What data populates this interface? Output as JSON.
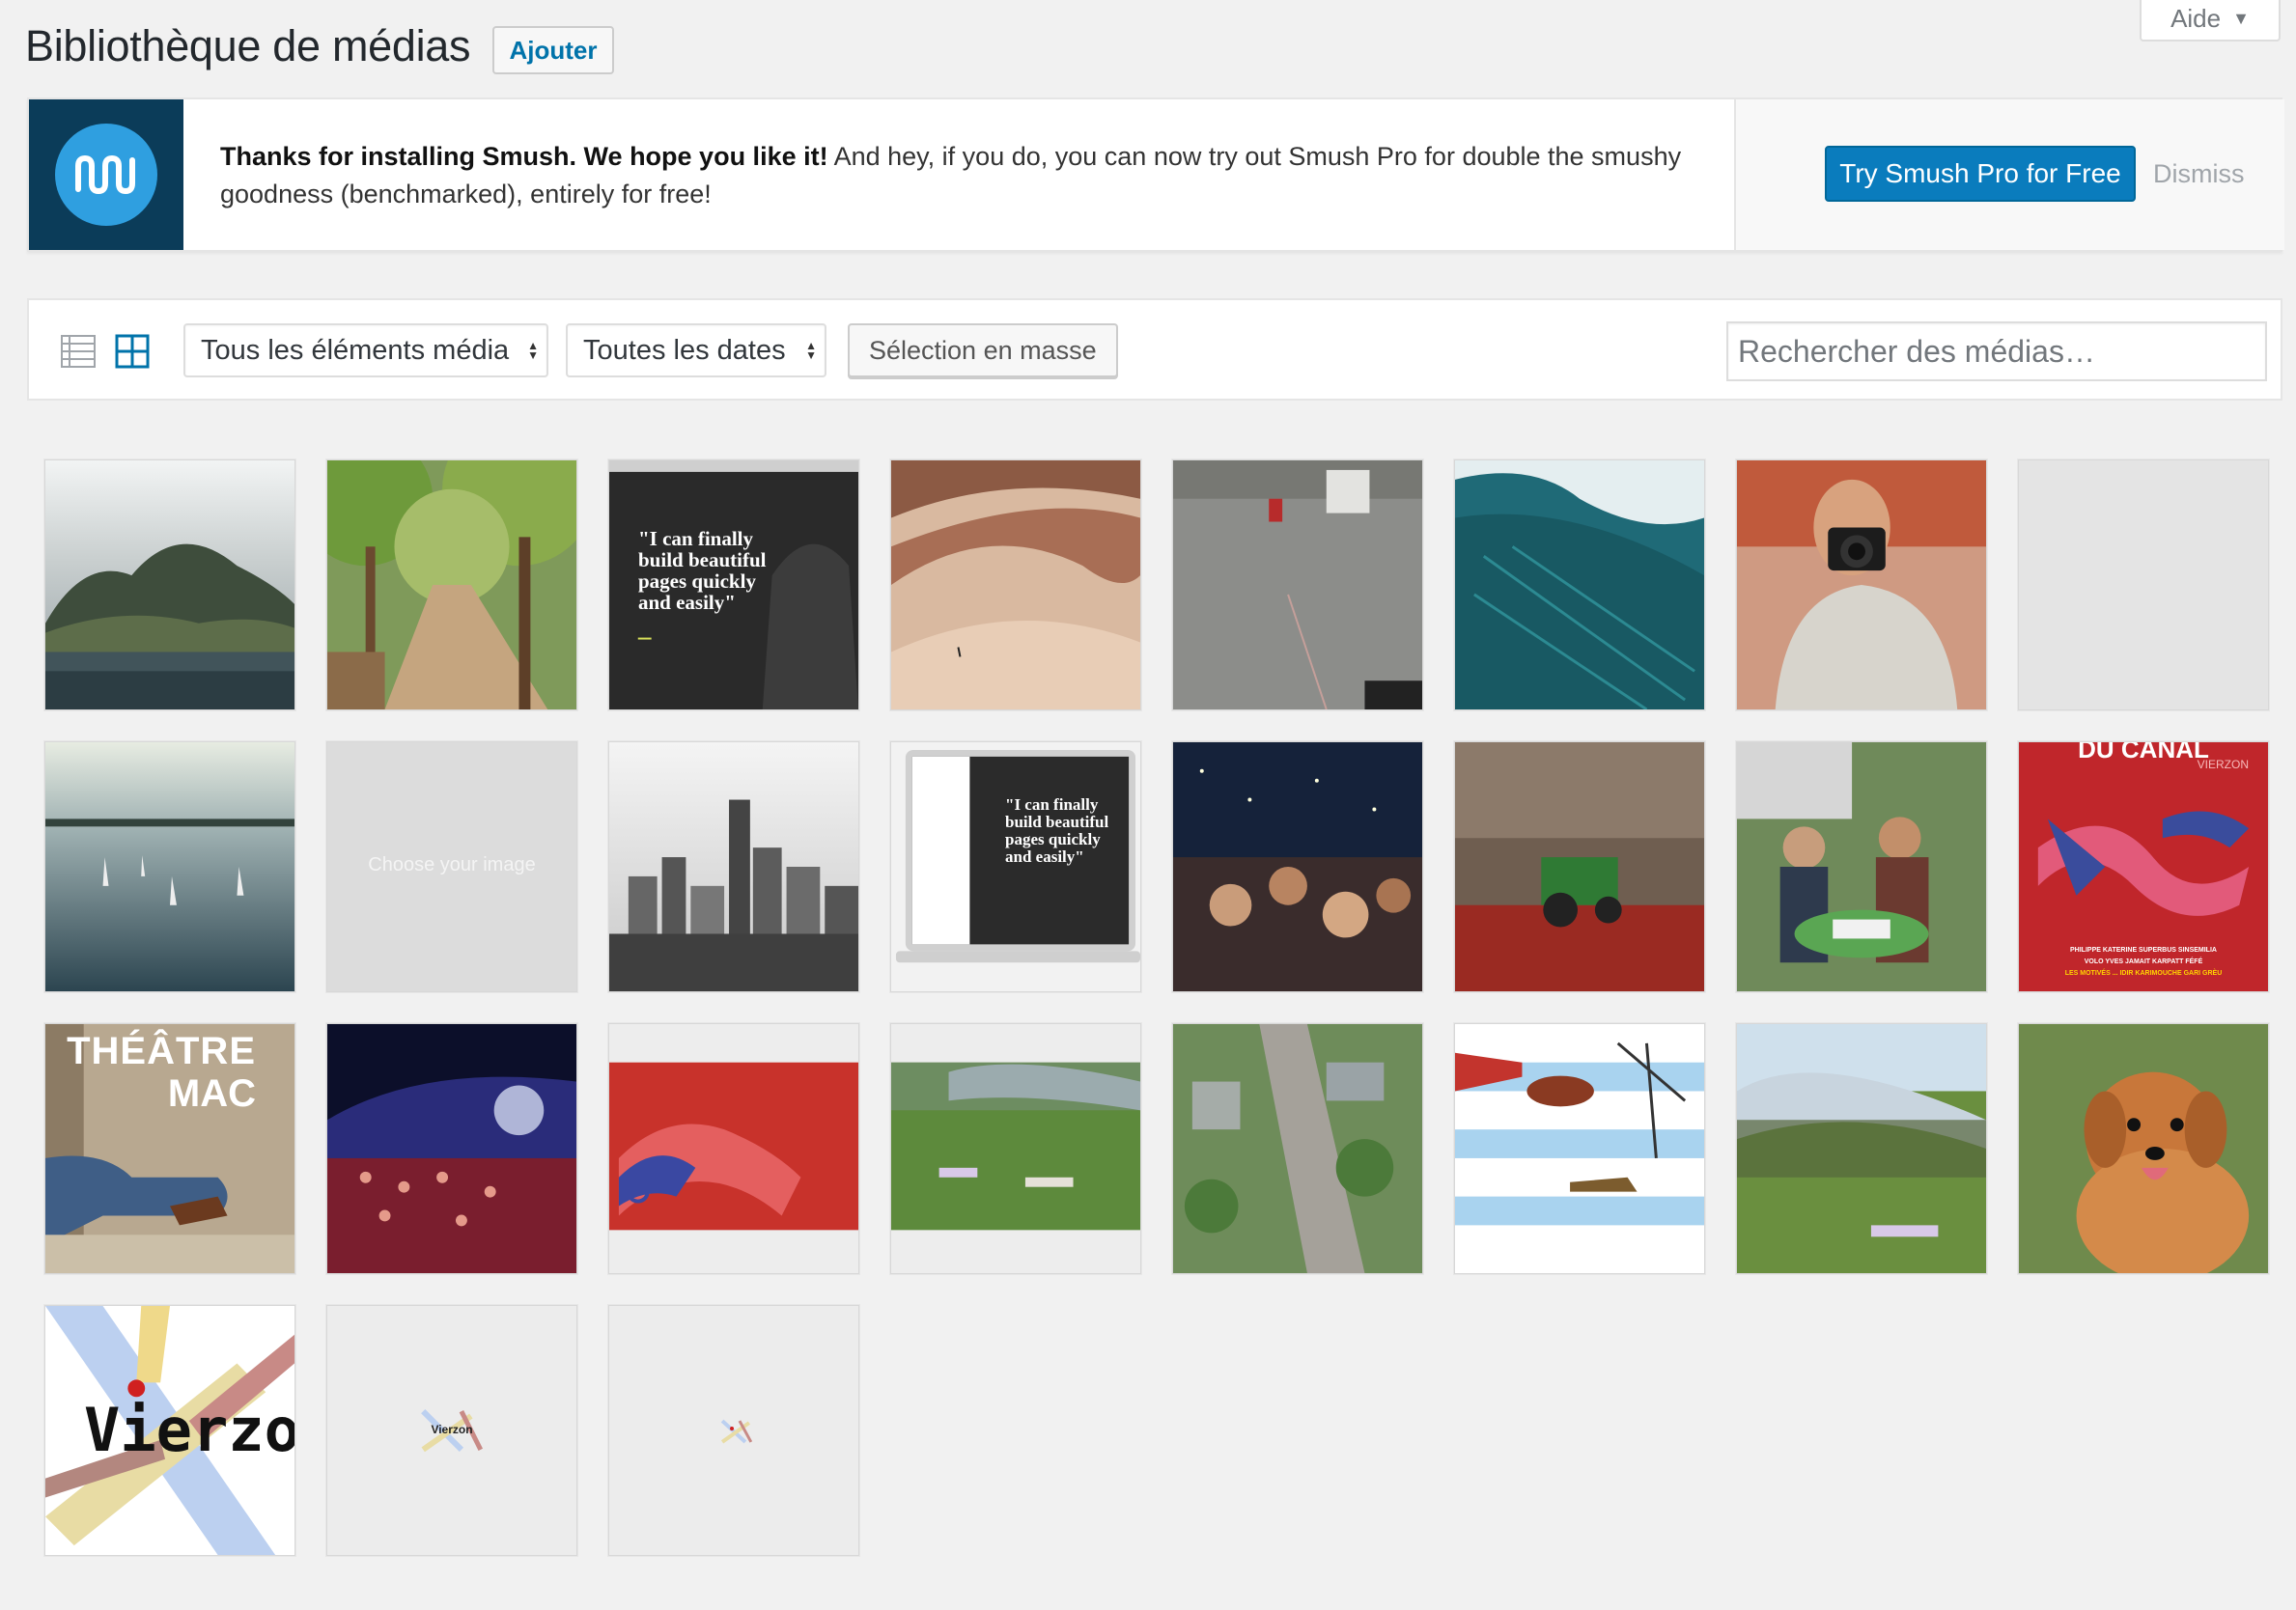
{
  "header": {
    "title": "Bibliothèque de médias",
    "add_button": "Ajouter",
    "help_tab": "Aide"
  },
  "notice": {
    "bold_text": "Thanks for installing Smush. We hope you like it!",
    "text": " And hey, if you do, you can now try out Smush Pro for double the smushy goodness (benchmarked), entirely for free!",
    "try_button": "Try Smush Pro for Free",
    "dismiss": "Dismiss",
    "logo_icon": "smush-logo-icon"
  },
  "toolbar": {
    "view_list_icon": "list-view-icon",
    "view_grid_icon": "grid-view-icon",
    "type_filter": "Tous les éléments média",
    "date_filter": "Toutes les dates",
    "bulk_select": "Sélection en masse",
    "search_placeholder": "Rechercher des médias…"
  },
  "media": {
    "quote_1": "\"I can finally build beautiful pages quickly and easily\"",
    "quote_2": "\"I can finally build beautiful pages quickly and easily\"",
    "placeholder_text": "Choose your image",
    "canal_text": "DU CANAL",
    "canal_sub": "VIERZON",
    "canal_lineup_1": "PHILIPPE KATERINE   SUPERBUS   SINSEMILIA",
    "canal_lineup_2": "VOLO   YVES JAMAIT   KARPATT   FÉFÉ",
    "canal_lineup_3": "LES MOTIVÉS ...   IDIR   KARIMOUCHE   GARI GRÈU",
    "theatre_text_1": "THÉÂTRE",
    "theatre_text_2": "MAC",
    "vierzon_text": "Vierzo",
    "vierzon_small": "Vierzon"
  },
  "colors": {
    "accent": "#0073aa",
    "primary_button": "#0a7cbd",
    "notice_logo_bg": "#0b3c59",
    "page_bg": "#f1f1f1"
  }
}
